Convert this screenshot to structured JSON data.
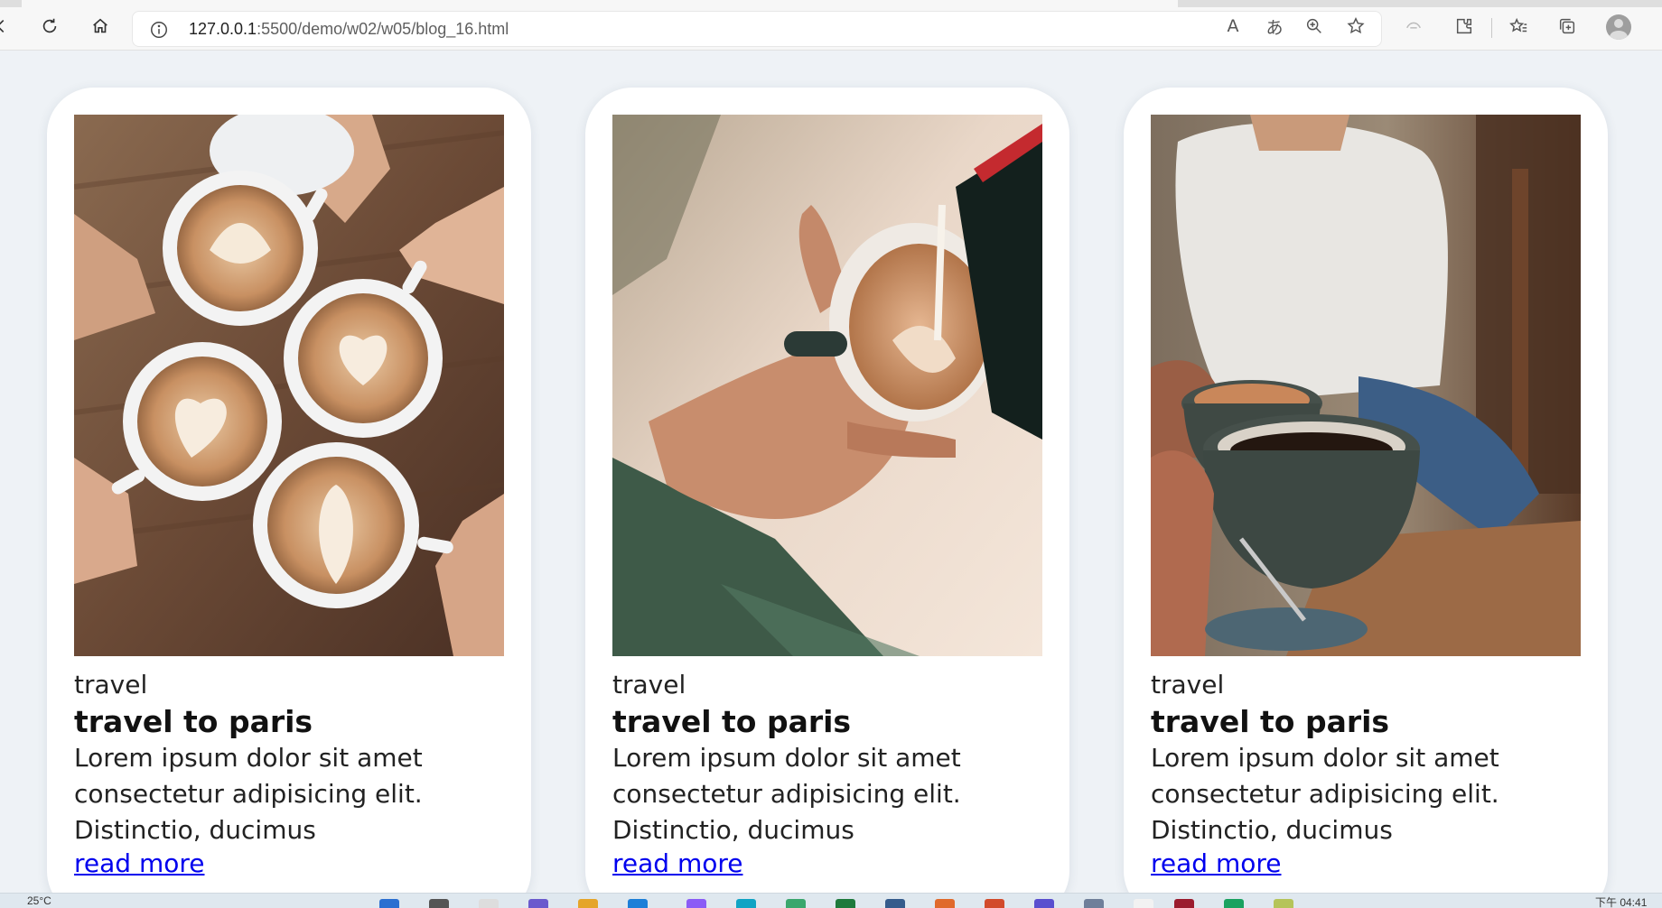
{
  "browser": {
    "url_host": "127.0.0.1",
    "url_rest": ":5500/demo/w02/w05/blog_16.html",
    "icons": [
      "back-icon",
      "refresh-icon",
      "home-icon",
      "site-info-icon",
      "read-aloud-icon",
      "translate-icon",
      "zoom-icon",
      "favorite-add-icon",
      "copilot-icon",
      "extensions-icon",
      "favorites-icon",
      "collections-icon",
      "profile-icon"
    ],
    "read_aloud_glyph": "A",
    "translate_glyph": "あ"
  },
  "cards": [
    {
      "photo": "latte-art-cups-photo",
      "category": "travel",
      "title": "travel to paris",
      "body": "Lorem ipsum dolor sit amet consectetur adipisicing elit. Distinctio, ducimus",
      "link": "read more"
    },
    {
      "photo": "pouring-milk-photo",
      "category": "travel",
      "title": "travel to paris",
      "body": "Lorem ipsum dolor sit amet consectetur adipisicing elit. Distinctio, ducimus",
      "link": "read more"
    },
    {
      "photo": "coffee-toast-photo",
      "category": "travel",
      "title": "travel to paris",
      "body": "Lorem ipsum dolor sit amet consectetur adipisicing elit. Distinctio, ducimus",
      "link": "read more"
    }
  ],
  "taskbar": {
    "weather": "25°C",
    "clock": "下午 04:41"
  },
  "colors": {
    "page_bg": "#eef2f6",
    "card_bg": "#ffffff",
    "link": "#0000ee"
  }
}
